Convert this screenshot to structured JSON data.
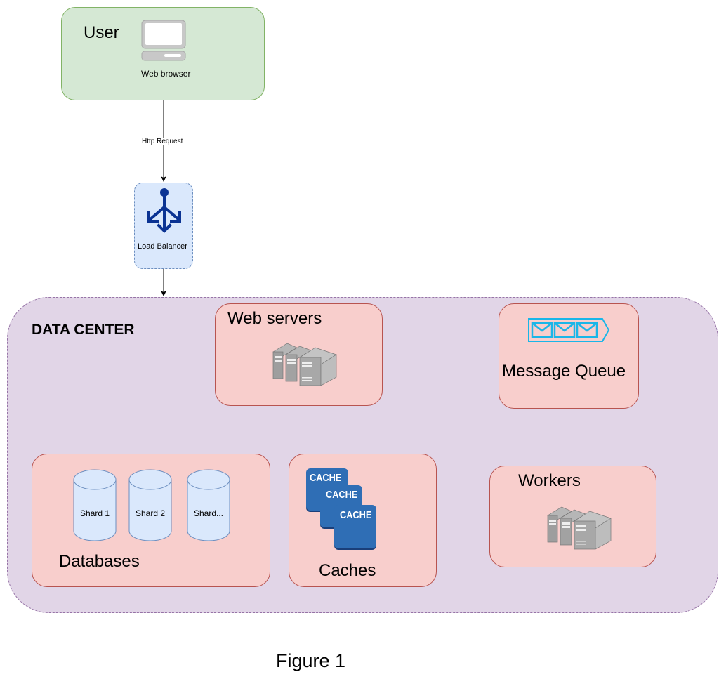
{
  "diagram": {
    "user": {
      "title": "User",
      "icon": "desktop-computer-icon",
      "caption": "Web browser"
    },
    "edge_user_lb": {
      "label": "Http Request"
    },
    "load_balancer": {
      "label": "Load Balancer",
      "icon": "load-balancer-icon"
    },
    "data_center": {
      "title": "DATA CENTER",
      "web_servers": {
        "title": "Web servers",
        "icon": "server-rack-icon"
      },
      "message_queue": {
        "title": "Message Queue",
        "icon": "message-queue-icon"
      },
      "databases": {
        "title": "Databases",
        "shards": [
          "Shard 1",
          "Shard 2",
          "Shard..."
        ]
      },
      "caches": {
        "title": "Caches",
        "items": [
          "CACHE",
          "CACHE",
          "CACHE"
        ]
      },
      "workers": {
        "title": "Workers",
        "icon": "server-rack-icon"
      }
    },
    "figure_caption": "Figure 1"
  },
  "colors": {
    "user_fill": "#d5e8d4",
    "lb_fill": "#dae8fc",
    "datacenter_fill": "#e1d5e7",
    "component_fill": "#f8cecc",
    "cache_blue": "#2f6eb5",
    "queue_cyan": "#1ab6e8",
    "lb_icon_blue": "#0b3393"
  }
}
